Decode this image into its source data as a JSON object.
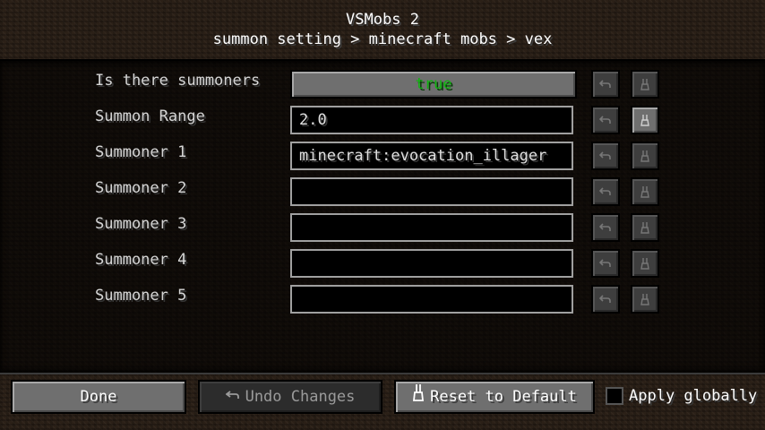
{
  "header": {
    "title": "VSMobs 2",
    "breadcrumb": "summon setting > minecraft mobs > vex"
  },
  "rows": [
    {
      "label": "Is there summoners",
      "type": "toggle",
      "value": "true",
      "reset_active": false
    },
    {
      "label": "Summon Range",
      "type": "text",
      "value": "2.0",
      "reset_active": true
    },
    {
      "label": "Summoner 1",
      "type": "text",
      "value": "minecraft:evocation_illager",
      "reset_active": false
    },
    {
      "label": "Summoner 2",
      "type": "text",
      "value": "",
      "reset_active": false
    },
    {
      "label": "Summoner 3",
      "type": "text",
      "value": "",
      "reset_active": false
    },
    {
      "label": "Summoner 4",
      "type": "text",
      "value": "",
      "reset_active": false
    },
    {
      "label": "Summoner 5",
      "type": "text",
      "value": "",
      "reset_active": false
    }
  ],
  "footer": {
    "done_label": "Done",
    "undo_label": "Undo Changes",
    "reset_label": "Reset to Default",
    "apply_globally_label": "Apply globally",
    "apply_globally_checked": false
  },
  "icons": {
    "undo": "undo-arrow-icon",
    "reset": "broom-reset-icon"
  },
  "colors": {
    "toggle_true_text": "#0fb50f"
  }
}
